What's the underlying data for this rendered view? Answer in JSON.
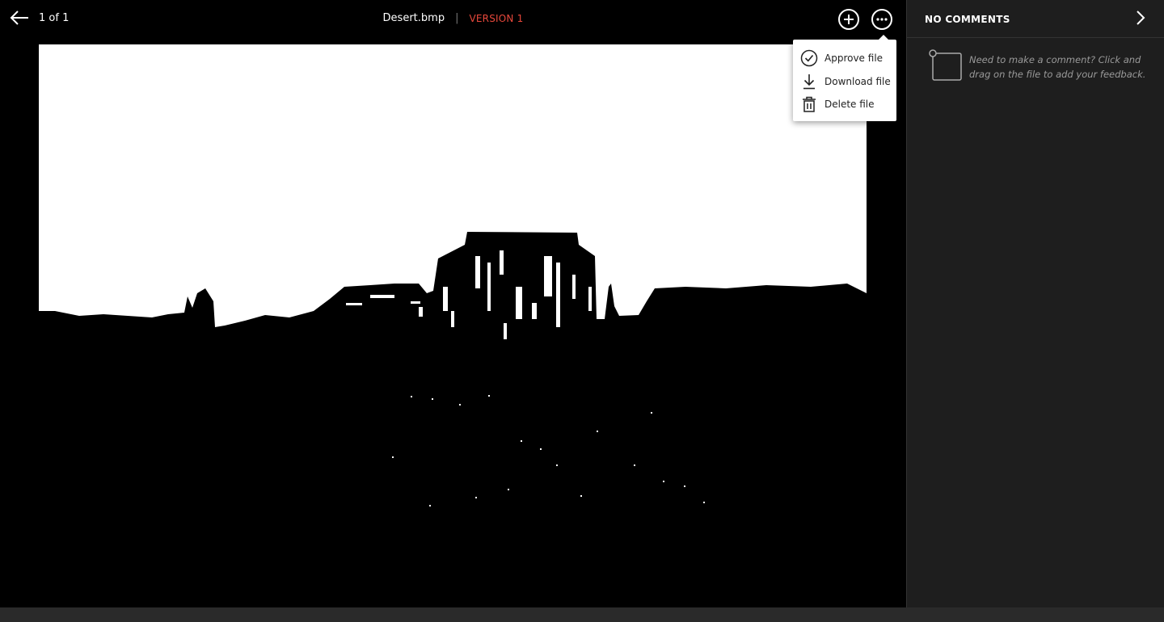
{
  "header": {
    "page_count": "1 of 1",
    "file_name": "Desert.bmp",
    "separator": "|",
    "version": "VERSION 1"
  },
  "icons": {
    "back": "arrow-left-icon",
    "add": "plus-circle-icon",
    "more": "ellipsis-circle-icon",
    "approve": "check-circle-icon",
    "download": "download-icon",
    "delete": "trash-icon",
    "collapse": "chevron-right-icon",
    "comment_hint": "comment-box-icon"
  },
  "menu": {
    "items": [
      {
        "label": "Approve file"
      },
      {
        "label": "Download file"
      },
      {
        "label": "Delete file"
      }
    ]
  },
  "comments": {
    "title": "NO COMMENTS",
    "hint": "Need to make a comment? Click and drag on the file to add your feedback."
  },
  "colors": {
    "version_accent": "#e8483b",
    "panel_bg": "#1e1e1e",
    "viewer_bg": "#000000"
  }
}
